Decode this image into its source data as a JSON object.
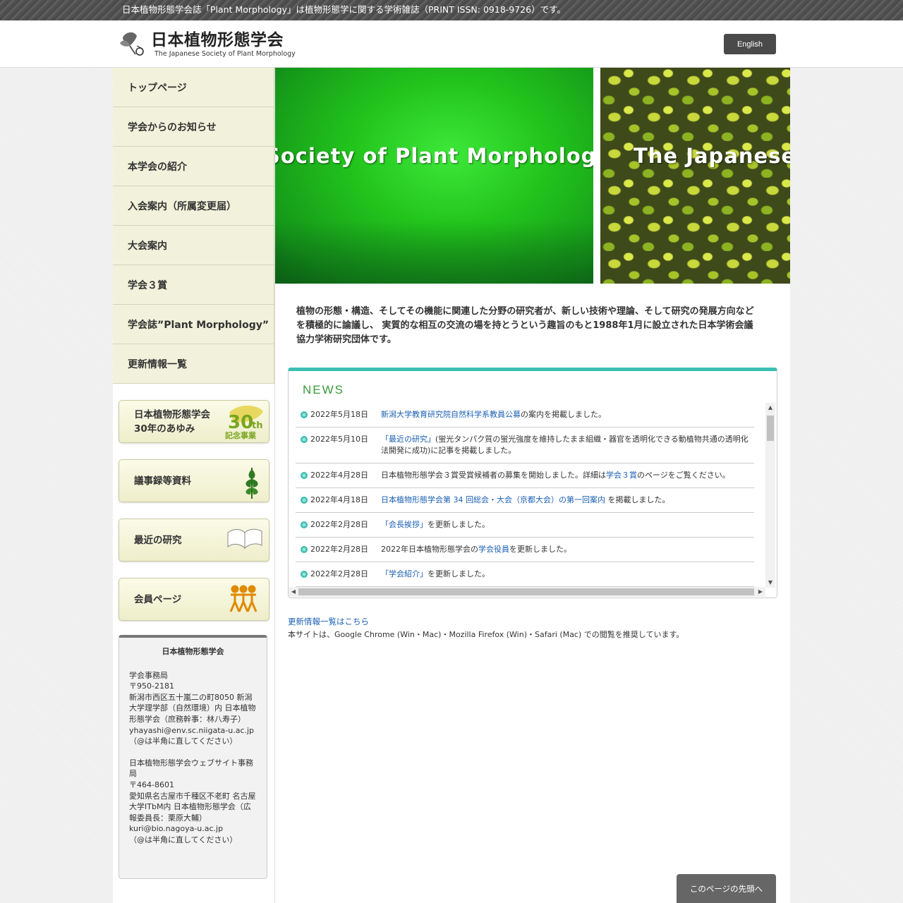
{
  "topbar": {
    "text": "日本植物形態学会誌「Plant Morphology」は植物形態学に関する学術雑誌（PRINT ISSN: 0918-9726）です。"
  },
  "header": {
    "logo_ja": "日本植物形態学会",
    "logo_en": "The Japanese Society of Plant Morphology",
    "lang_button": "English"
  },
  "nav": {
    "items": [
      "トップページ",
      "学会からのお知らせ",
      "本学会の紹介",
      "入会案内（所属変更届）",
      "大会案内",
      "学会３賞",
      "学会誌”Plant Morphology”",
      "更新情報一覧"
    ]
  },
  "banners": {
    "history_line1": "日本植物形態学会",
    "history_line2": "30年のあゆみ",
    "badge_30": "30",
    "badge_th": "th",
    "badge_caption": "記念事業",
    "minutes": "議事録等資料",
    "research": "最近の研究",
    "members": "会員ページ"
  },
  "contact": {
    "title": "日本植物形態学会",
    "office1_name": "学会事務局",
    "office1_zip": "〒950-2181",
    "office1_address": "新潟市西区五十嵐二の町8050 新潟大学理学部（自然環境）内 日本植物形態学会（庶務幹事：林八寿子）",
    "office1_email": "yhayashi@env.sc.niigata-u.ac.jp",
    "office1_note": "（@は半角に直してください）",
    "office2_name": "日本植物形態学会ウェブサイト事務局",
    "office2_zip": "〒464-8601",
    "office2_address": "愛知県名古屋市千種区不老町 名古屋大学ITbM内 日本植物形態学会（広報委員長：栗原大輔）",
    "office2_email": "kuri@bio.nagoya-u.ac.jp",
    "office2_note": "（@は半角に直してください）"
  },
  "hero": {
    "left_text": "Society of Plant Morphology",
    "right_text": "The Japanese S"
  },
  "intro": {
    "text": "植物の形態・構造、そしてその機能に関連した分野の研究者が、新しい技術や理論、そして研究の発展方向などを積極的に論議し、 実質的な相互の交流の場を持とうという趣旨のもと1988年1月に設立された日本学術会議協力学術研究団体です。"
  },
  "news": {
    "title": "NEWS",
    "items": [
      {
        "date": "2022年5月18日",
        "link": "新潟大学教育研究院自然科学系教員公募",
        "after": "の案内を掲載しました。",
        "link2": "",
        "after2": ""
      },
      {
        "date": "2022年5月10日",
        "link": "「最近の研究」",
        "after": "(蛍光タンパク質の蛍光強度を維持したまま組織・器官を透明化できる動植物共通の透明化法開発に成功)に記事を掲載しました。",
        "link2": "",
        "after2": ""
      },
      {
        "date": "2022年4月28日",
        "before": "日本植物形態学会３賞受賞候補者の募集を開始しました。詳細は",
        "link": "学会３賞",
        "after": "のページをご覧ください。"
      },
      {
        "date": "2022年4月18日",
        "link": "日本植物形態学会第 34 回総会・大会（京都大会）の第一回案内",
        "after": " を掲載しました。"
      },
      {
        "date": "2022年2月28日",
        "link": "「会長挨拶」",
        "after": "を更新しました。"
      },
      {
        "date": "2022年2月28日",
        "before": "2022年日本植物形態学会の",
        "link": "学会役員",
        "after": "を更新しました。"
      },
      {
        "date": "2022年2月28日",
        "link": "「学会紹介」",
        "after": "を更新しました。"
      }
    ],
    "more_link": "更新情報一覧はこちら",
    "browser_note": "本サイトは、Google Chrome (Win・Mac)・Mozilla Firefox (Win)・Safari (Mac) での閲覧を推奨しています。"
  },
  "totop": "このページの先頭へ",
  "colors": {
    "nav_bg": "#f2f2dc",
    "news_accent": "#3bbfb3",
    "news_title": "#3a9a3a",
    "link": "#1a5fb4"
  }
}
